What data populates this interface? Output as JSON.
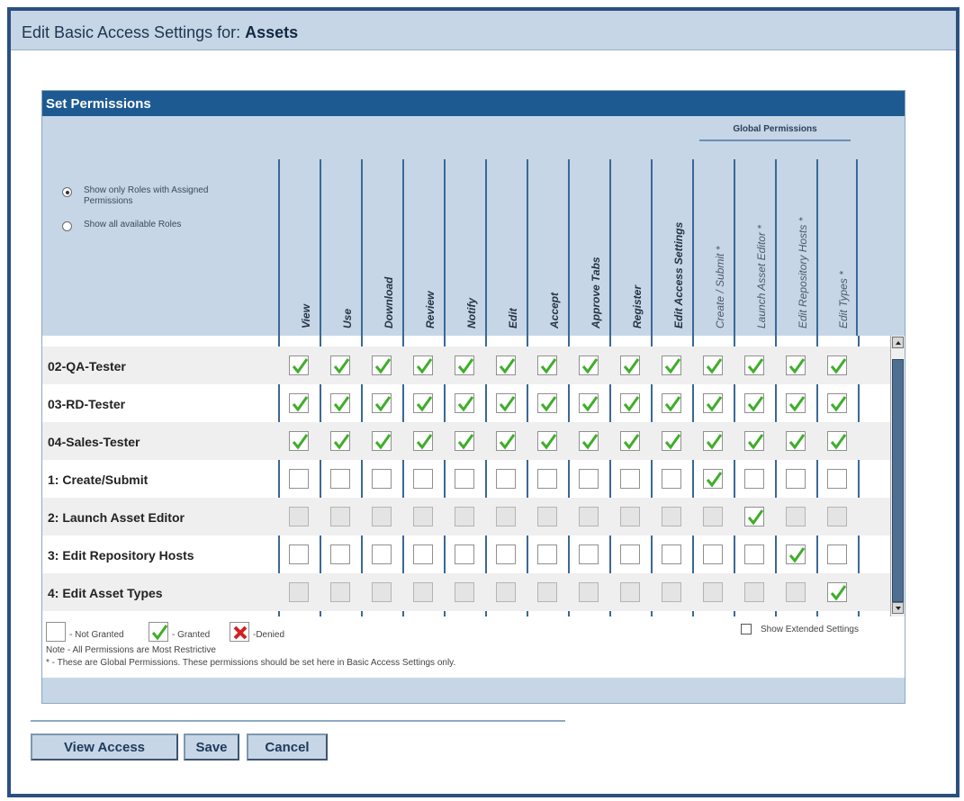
{
  "title": {
    "prefix": "Edit Basic Access Settings for:",
    "object": "Assets"
  },
  "panel": {
    "header": "Set Permissions",
    "global_label": "Global Permissions",
    "radio_options": [
      {
        "label": "Show only Roles with Assigned Permissions",
        "selected": true
      },
      {
        "label": "Show all available Roles",
        "selected": false
      }
    ]
  },
  "columns": [
    {
      "label": "View",
      "global": false
    },
    {
      "label": "Use",
      "global": false
    },
    {
      "label": "Download",
      "global": false
    },
    {
      "label": "Review",
      "global": false
    },
    {
      "label": "Notify",
      "global": false
    },
    {
      "label": "Edit",
      "global": false
    },
    {
      "label": "Accept",
      "global": false
    },
    {
      "label": "Approve Tabs",
      "global": false
    },
    {
      "label": "Register",
      "global": false
    },
    {
      "label": "Edit Access Settings",
      "global": false
    },
    {
      "label": "Create / Submit *",
      "global": true
    },
    {
      "label": "Launch Asset Editor *",
      "global": true
    },
    {
      "label": "Edit Repository Hosts *",
      "global": true
    },
    {
      "label": "Edit Types *",
      "global": true
    }
  ],
  "rows": [
    {
      "name": "02-QA-Tester",
      "disabled": false,
      "granted": [
        0,
        1,
        2,
        3,
        4,
        5,
        6,
        7,
        8,
        9,
        10,
        11,
        12,
        13
      ]
    },
    {
      "name": "03-RD-Tester",
      "disabled": false,
      "granted": [
        0,
        1,
        2,
        3,
        4,
        5,
        6,
        7,
        8,
        9,
        10,
        11,
        12,
        13
      ]
    },
    {
      "name": "04-Sales-Tester",
      "disabled": false,
      "granted": [
        0,
        1,
        2,
        3,
        4,
        5,
        6,
        7,
        8,
        9,
        10,
        11,
        12,
        13
      ]
    },
    {
      "name": "1: Create/Submit",
      "disabled": false,
      "granted": [
        10
      ]
    },
    {
      "name": "2: Launch Asset Editor",
      "disabled": true,
      "granted": [
        11
      ]
    },
    {
      "name": "3: Edit Repository Hosts",
      "disabled": false,
      "granted": [
        12
      ]
    },
    {
      "name": "4: Edit Asset Types",
      "disabled": true,
      "granted": [
        13
      ]
    }
  ],
  "legend": {
    "not_granted": "- Not Granted",
    "granted": "- Granted",
    "denied": "-Denied",
    "show_extended": "Show Extended Settings",
    "note": "Note - All Permissions are Most Restrictive",
    "global_note": "* - These are Global Permissions. These permissions should be set here in Basic Access Settings only."
  },
  "buttons": {
    "view_access": "View Access",
    "save": "Save",
    "cancel": "Cancel"
  },
  "colors": {
    "check": "#3fae2a",
    "denied": "#d42020",
    "header_blue": "#1e5a92"
  }
}
